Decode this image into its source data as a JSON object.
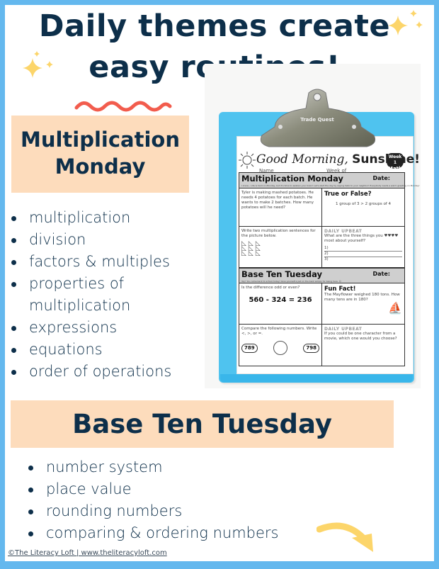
{
  "header": {
    "line1": "Daily themes create",
    "line2": "easy routines!"
  },
  "colors": {
    "border": "#64b8ee",
    "navy": "#0d2f4a",
    "peach": "#fddcbc",
    "squiggle": "#f25c4d",
    "sparkle": "#fcd56a",
    "arrow": "#fcd56a"
  },
  "multiplication_monday": {
    "heading_line1": "Multiplication",
    "heading_line2": "Monday",
    "items": [
      "multiplication",
      "division",
      "factors & multiples",
      "properties of",
      "multiplication",
      "expressions",
      "equations",
      "order of operations"
    ]
  },
  "base_ten_tuesday": {
    "heading": "Base Ten Tuesday",
    "items": [
      "number system",
      "place value",
      "rounding numbers",
      "comparing & ordering numbers"
    ]
  },
  "worksheet": {
    "clip_brand": "Trade Quest",
    "title_script": "Good Morning,",
    "title_bold": "Sunshine!",
    "badge_line1": "Week 1",
    "badge_line2": "Math",
    "name_label": "Name ____________________",
    "week_label": "Week of __________",
    "section1": {
      "title": "Multiplication Monday",
      "date_label": "Date:",
      "subtitle": "I know... Life is hard on Monday, but it's time to awaken your brain! Let's start the day by saying hello to your neighbor! Everybody needs a warm greeting on Monday!",
      "cell1": "Tyler is making mashed potatoes. He needs 4 potatoes for each batch. He wants to make 2 batches. How many potatoes will he need?",
      "cell2_heading": "True or False?",
      "cell2_body": "1 group of 3 > 2 groups of 4",
      "cell3": "Write two multiplication sentences for the picture below.",
      "cell4_heading": "DAILY UPBEAT",
      "cell4_body": "What are the three things you ♥♥♥♥ most about yourself?",
      "cell4_lines": [
        "1)",
        "2)",
        "3)"
      ]
    },
    "section2": {
      "title": "Base Ten Tuesday",
      "date_label": "Date:",
      "subtitle": "Yay! You came back to school today! Give yourself a pat on the back simply for being here. ☺",
      "cell1": "Is the difference odd or even?",
      "cell1_equation": "560 - 324 = 236",
      "cell2_heading": "Fun Fact!",
      "cell2_body": "The Mayflower weighed 180 tons. How many tens are in 180?",
      "cell3": "Compare the following numbers. Write <, >, or =.",
      "cell3_left": "789",
      "cell3_right": "798",
      "cell4_heading": "DAILY UPBEAT",
      "cell4_body": "If you could be one character from a movie, which one would you choose?"
    }
  },
  "footer": {
    "credit": "©The Literacy Loft | www.theliteracyloft.com"
  }
}
